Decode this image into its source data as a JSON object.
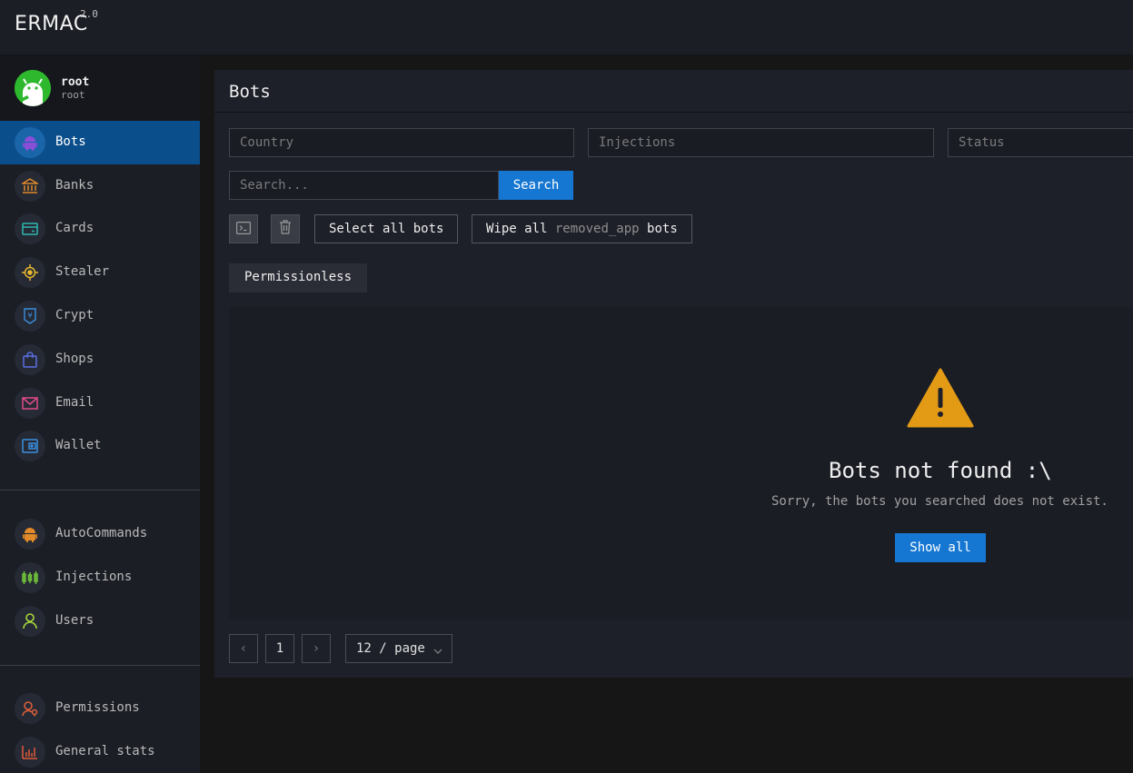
{
  "app": {
    "name": "ERMAC",
    "version": "2.0"
  },
  "user": {
    "name": "root",
    "role": "root"
  },
  "sidebar": {
    "items": [
      {
        "label": "Bots",
        "icon": "android-icon",
        "color": "#8a4fd8",
        "active": true
      },
      {
        "label": "Banks",
        "icon": "bank-icon",
        "color": "#e08a2a"
      },
      {
        "label": "Cards",
        "icon": "credit-card-icon",
        "color": "#2fb8b0"
      },
      {
        "label": "Stealer",
        "icon": "crosshair-icon",
        "color": "#e8b830"
      },
      {
        "label": "Crypt",
        "icon": "crypto-icon",
        "color": "#3a8fe0"
      },
      {
        "label": "Shops",
        "icon": "shopping-bag-icon",
        "color": "#5a6ee0"
      },
      {
        "label": "Email",
        "icon": "mail-icon",
        "color": "#e04a8a"
      },
      {
        "label": "Wallet",
        "icon": "wallet-icon",
        "color": "#3a8fe0"
      }
    ],
    "secondary": [
      {
        "label": "AutoCommands",
        "icon": "android-icon",
        "color": "#e08a2a"
      },
      {
        "label": "Injections",
        "icon": "injections-icon",
        "color": "#6fc23a"
      },
      {
        "label": "Users",
        "icon": "user-icon",
        "color": "#a8d83a"
      }
    ],
    "tertiary": [
      {
        "label": "Permissions",
        "icon": "user-permissions-icon",
        "color": "#e0603a"
      },
      {
        "label": "General stats",
        "icon": "bar-chart-icon",
        "color": "#e05a3a"
      }
    ]
  },
  "main": {
    "title": "Bots",
    "filters": {
      "country_placeholder": "Country",
      "injections_placeholder": "Injections",
      "status_placeholder": "Status"
    },
    "search": {
      "placeholder": "Search...",
      "button": "Search"
    },
    "actions": {
      "select_all": "Select all bots",
      "wipe_prefix": "Wipe all",
      "wipe_keyword": "removed_app",
      "wipe_suffix": "bots"
    },
    "tab": "Permissionless",
    "empty": {
      "title": "Bots not found :\\",
      "subtitle": "Sorry, the bots you searched does not exist.",
      "button": "Show all"
    },
    "pagination": {
      "prev": "‹",
      "current": "1",
      "next": "›",
      "page_size": "12 / page"
    }
  },
  "colors": {
    "accent": "#1677d2",
    "active_nav": "#0b4e8c",
    "warning": "#e39b16"
  }
}
